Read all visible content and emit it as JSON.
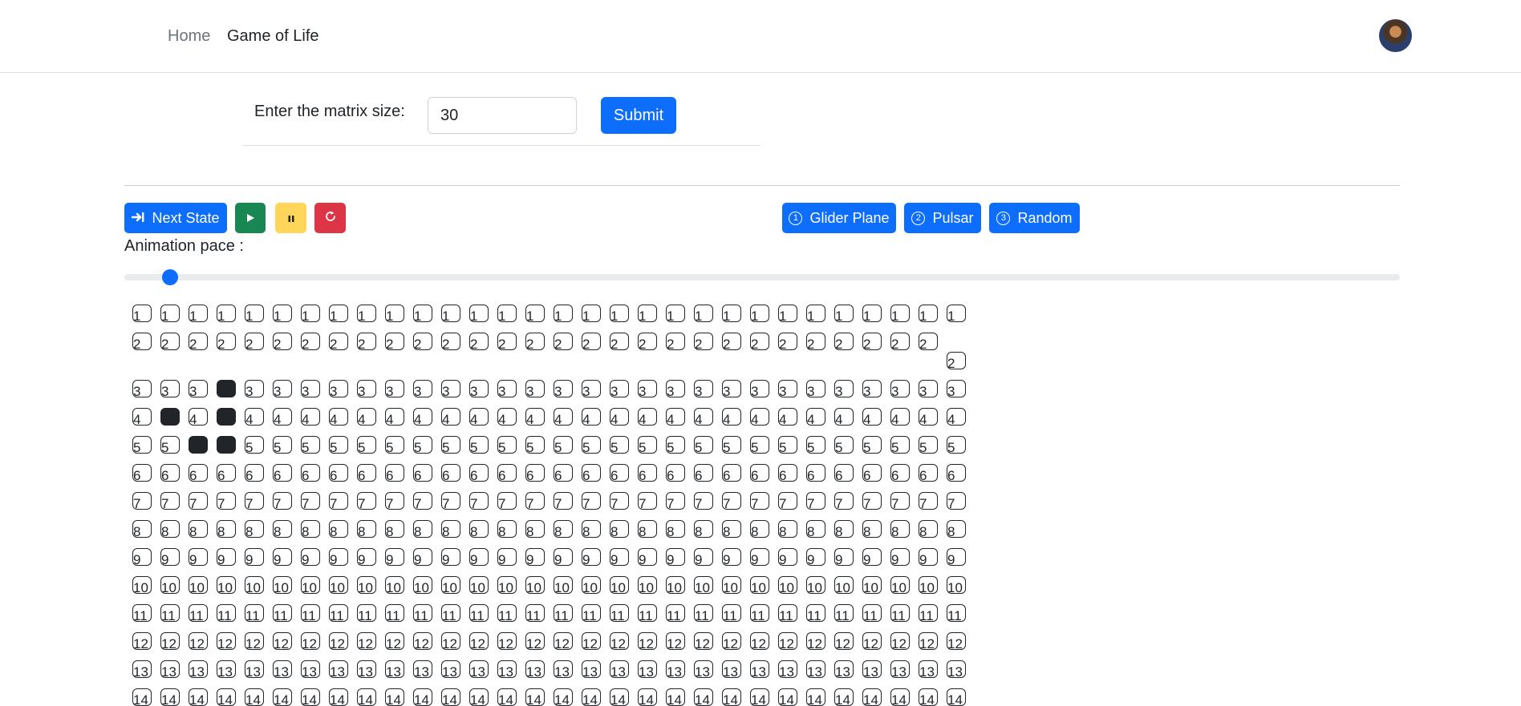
{
  "nav": {
    "links": [
      "Home",
      "Game of Life"
    ]
  },
  "form": {
    "label": "Enter the matrix size:",
    "value": "30",
    "submit_label": "Submit"
  },
  "controls": {
    "next_state_label": "Next State",
    "next_state_icon": "arrow-to-line-icon",
    "play_icon": "play-icon",
    "pause_icon": "pause-icon",
    "reset_icon": "reset-icon",
    "presets": [
      {
        "number": "1",
        "label": "Glider Plane"
      },
      {
        "number": "2",
        "label": "Pulsar"
      },
      {
        "number": "3",
        "label": "Random"
      }
    ]
  },
  "animation": {
    "label": "Animation pace :",
    "value_fraction": 0.03
  },
  "grid": {
    "columns": 30,
    "visible_rows": [
      "1",
      "2",
      "3",
      "4",
      "5",
      "6",
      "7",
      "8",
      "9",
      "10",
      "11",
      "12",
      "13",
      "14"
    ],
    "alive": [
      [
        3,
        4
      ],
      [
        4,
        2
      ],
      [
        4,
        4
      ],
      [
        5,
        3
      ],
      [
        5,
        4
      ]
    ],
    "wrapped_last_cell_row": 2
  },
  "colors": {
    "primary": "#0d6efd",
    "success": "#198754",
    "warning": "#ffd65a",
    "danger": "#dc3545",
    "cell_border": "#212529",
    "cell_alive": "#212529"
  }
}
